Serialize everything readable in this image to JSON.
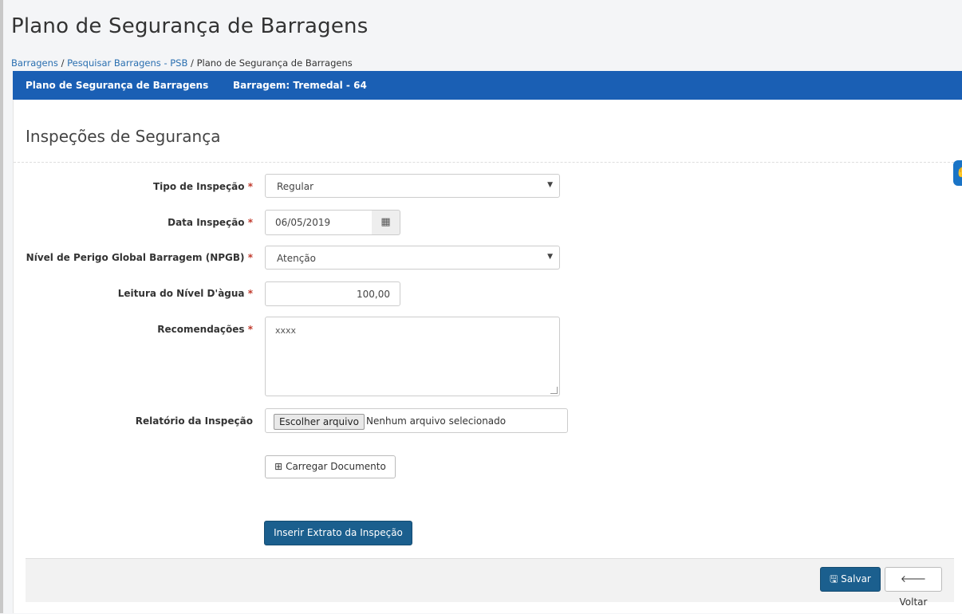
{
  "page": {
    "title": "Plano de Segurança de Barragens"
  },
  "breadcrumb": {
    "item1": "Barragens",
    "item2": "Pesquisar Barragens - PSB",
    "current": "Plano de Segurança de Barragens",
    "separator": "/"
  },
  "navbar": {
    "title": "Plano de Segurança de Barragens",
    "dam": "Barragem: Tremedal - 64",
    "color": "#1a5fb4"
  },
  "section": {
    "title": "Inspeções de Segurança"
  },
  "form": {
    "required_mark": "*",
    "tipo": {
      "label": "Tipo de Inspeção",
      "value": "Regular"
    },
    "data": {
      "label": "Data Inspeção",
      "value": "06/05/2019",
      "icon": "calendar-icon"
    },
    "npgb": {
      "label": "Nível de Perigo Global Barragem (NPGB)",
      "value": "Atenção"
    },
    "leitura": {
      "label": "Leitura do Nível D'àgua",
      "value": "100,00"
    },
    "recomendacoes": {
      "label": "Recomendações",
      "value": "xxxx"
    },
    "relatorio": {
      "label": "Relatório da Inspeção",
      "button": "Escolher arquivo",
      "status": "Nenhum arquivo selecionado"
    },
    "carregar": {
      "label": "Carregar Documento",
      "icon": "plus-square-icon"
    },
    "inserir": {
      "label": "Inserir Extrato da Inspeção"
    }
  },
  "footer": {
    "save": {
      "label": "Salvar",
      "icon": "floppy-icon"
    },
    "back": {
      "label": "Voltar",
      "icon": "arrow-left-icon"
    }
  },
  "colors": {
    "primary_button": "#1b5f8e",
    "required": "#c0392b",
    "link": "#2a6fb0"
  }
}
